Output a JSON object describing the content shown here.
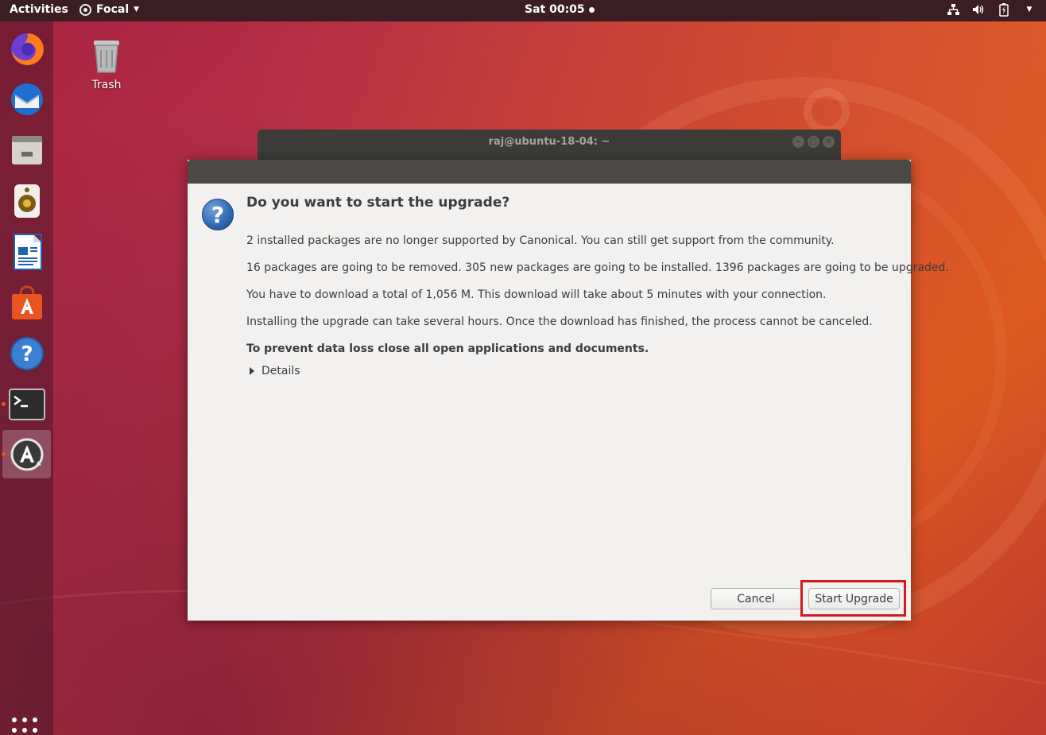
{
  "topbar": {
    "activities": "Activities",
    "app_name": "Focal",
    "clock": "Sat 00:05"
  },
  "desktop": {
    "trash_label": "Trash"
  },
  "dock": {
    "items": [
      "firefox-icon",
      "thunderbird-icon",
      "files-icon",
      "rhythmbox-icon",
      "libreoffice-writer-icon",
      "software-center-icon",
      "help-icon",
      "terminal-icon",
      "software-updater-icon"
    ]
  },
  "terminal_window": {
    "title": "raj@ubuntu-18-04: ~"
  },
  "dialog": {
    "heading": "Do you want to start the upgrade?",
    "lines": [
      "2 installed packages are no longer supported by Canonical. You can still get support from the community.",
      "16 packages are going to be removed. 305 new packages are going to be installed. 1396 packages are going to be upgraded.",
      "You have to download a total of 1,056 M. This download will take about 5 minutes with your connection.",
      "Installing the upgrade can take several hours. Once the download has finished, the process cannot be canceled."
    ],
    "warning": "To prevent data loss close all open applications and documents.",
    "details_label": "Details",
    "cancel_label": "Cancel",
    "start_label": "Start Upgrade"
  },
  "colors": {
    "highlight": "#d11a22",
    "ubuntu_orange": "#e95420"
  }
}
